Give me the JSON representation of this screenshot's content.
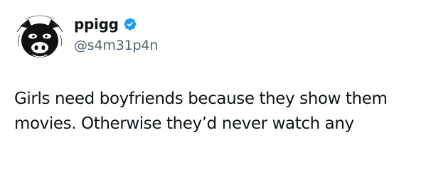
{
  "author": {
    "display_name": "ppigg",
    "handle": "@s4m31p4n",
    "verified": true,
    "verified_icon": "verified-badge-icon",
    "avatar_icon": "pig-face-avatar"
  },
  "tweet": {
    "text": "Girls need boyfriends because they show them movies. Otherwise they’d never watch any"
  },
  "colors": {
    "text_primary": "#0f1419",
    "text_secondary": "#536471",
    "verified_blue": "#1d9bf0",
    "background": "#ffffff"
  }
}
